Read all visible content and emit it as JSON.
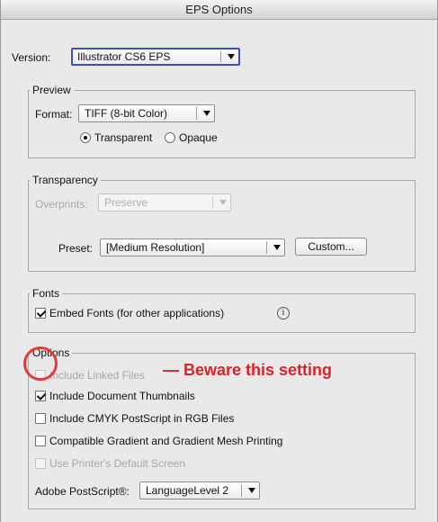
{
  "window": {
    "title": "EPS Options"
  },
  "version": {
    "label": "Version:",
    "value": "Illustrator CS6 EPS"
  },
  "preview": {
    "group_title": "Preview",
    "format_label": "Format:",
    "format_value": "TIFF (8-bit Color)",
    "radio_transparent": "Transparent",
    "radio_opaque": "Opaque",
    "selected": "Transparent"
  },
  "transparency": {
    "group_title": "Transparency",
    "overprints_label": "Overprints:",
    "overprints_value": "Preserve",
    "preset_label": "Preset:",
    "preset_value": "[Medium Resolution]",
    "custom_button": "Custom..."
  },
  "fonts": {
    "group_title": "Fonts",
    "embed_label": "Embed Fonts (for other applications)",
    "embed_checked": true,
    "info_icon": "i"
  },
  "options": {
    "group_title": "Options",
    "items": [
      {
        "label": "Include Linked Files",
        "checked": false,
        "enabled": false
      },
      {
        "label": "Include Document Thumbnails",
        "checked": true,
        "enabled": true
      },
      {
        "label": "Include CMYK PostScript in RGB Files",
        "checked": false,
        "enabled": true
      },
      {
        "label": "Compatible Gradient and Gradient Mesh Printing",
        "checked": false,
        "enabled": true
      },
      {
        "label": "Use Printer's Default Screen",
        "checked": false,
        "enabled": false
      }
    ],
    "postscript_label": "Adobe PostScript®:",
    "postscript_value": "LanguageLevel 2"
  },
  "annotation": {
    "text": "— Beware this setting",
    "color": "#e21f26"
  },
  "colors": {
    "focus": "#3b4ec9",
    "annotation": "#e21f26"
  }
}
